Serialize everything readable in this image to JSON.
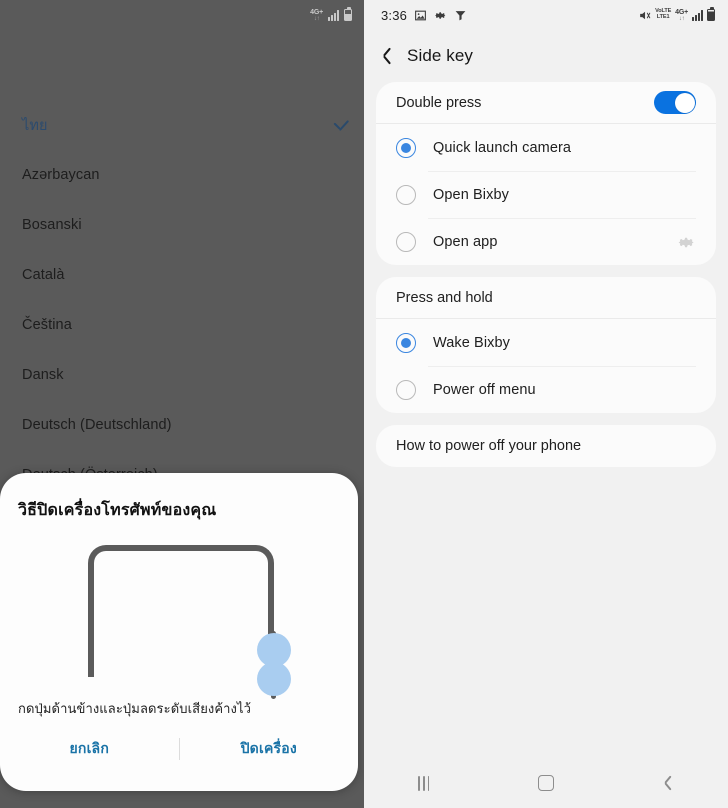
{
  "left_panel": {
    "status_bar": {
      "network_label": "4G+",
      "network_sublabel": "↓↑",
      "signal_icon": "signal-bars-icon",
      "battery_icon": "battery-icon"
    },
    "language_list": {
      "items": [
        {
          "label": "ไทย",
          "selected": true,
          "check_icon": "check-icon"
        },
        {
          "label": "Azərbaycan",
          "selected": false
        },
        {
          "label": "Bosanski",
          "selected": false
        },
        {
          "label": "Català",
          "selected": false
        },
        {
          "label": "Čeština",
          "selected": false
        },
        {
          "label": "Dansk",
          "selected": false
        },
        {
          "label": "Deutsch (Deutschland)",
          "selected": false
        },
        {
          "label": "Deutsch (Österreich)",
          "selected": false
        }
      ]
    },
    "dialog": {
      "title": "วิธีปิดเครื่องโทรศัพท์ของคุณ",
      "body": "กดปุ่มด้านข้างและปุ่มลดระดับเสียงค้างไว้",
      "illustration": "phone-side-buttons-illustration",
      "cancel_label": "ยกเลิก",
      "confirm_label": "ปิดเครื่อง",
      "accent_color": "#1a73a7"
    }
  },
  "right_panel": {
    "status_bar": {
      "clock": "3:36",
      "left_icons": [
        "image-icon",
        "gear-icon",
        "filter-icon"
      ],
      "mute_icon": "mute-icon",
      "volte_line1": "VoLTE",
      "volte_line2": "LTE1",
      "network_label": "4G+",
      "network_sublabel": "↓↑",
      "signal_icon": "signal-bars-icon",
      "battery_icon": "battery-icon"
    },
    "header": {
      "back_icon": "back-chevron-icon",
      "title": "Side key"
    },
    "double_press_card": {
      "title": "Double press",
      "toggle_on": true,
      "options": [
        {
          "label": "Quick launch camera",
          "selected": true,
          "settings_icon": null
        },
        {
          "label": "Open Bixby",
          "selected": false,
          "settings_icon": null
        },
        {
          "label": "Open app",
          "selected": false,
          "settings_icon": "gear-icon"
        }
      ]
    },
    "press_hold_card": {
      "title": "Press and hold",
      "options": [
        {
          "label": "Wake Bixby",
          "selected": true
        },
        {
          "label": "Power off menu",
          "selected": false
        }
      ]
    },
    "how_to_card": {
      "label": "How to power off your phone"
    },
    "nav_bar": {
      "recents_icon": "recents-icon",
      "home_icon": "home-icon",
      "back_icon": "back-icon"
    },
    "accent_color": "#0a72e0"
  }
}
